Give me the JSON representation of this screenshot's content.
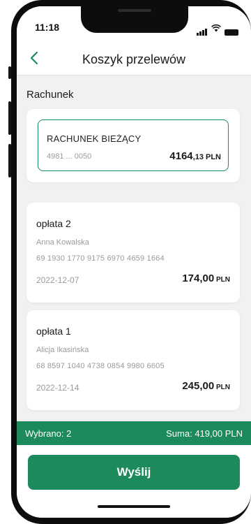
{
  "status_bar": {
    "time": "11:18"
  },
  "header": {
    "title": "Koszyk przelewów"
  },
  "account_section": {
    "label": "Rachunek",
    "account": {
      "name": "RACHUNEK BIEŻĄCY",
      "number": "4981 ... 0050",
      "balance_main": "4164",
      "balance_fraction": ",13 PLN"
    }
  },
  "transfers": [
    {
      "title": "opłata 2",
      "recipient": "Anna Kowalska",
      "account_number": "69 1930 1770 9175 6970 4659 1664",
      "date": "2022-12-07",
      "amount_main": "174,00",
      "currency": " PLN"
    },
    {
      "title": "opłata 1",
      "recipient": "Alicja Ikasińska",
      "account_number": "68 8597 1040 4738 0854 9980 6605",
      "date": "2022-12-14",
      "amount_main": "245,00",
      "currency": " PLN"
    }
  ],
  "summary": {
    "selected": "Wybrano: 2",
    "total": "Suma: 419,00 PLN"
  },
  "actions": {
    "send_label": "Wyślij"
  },
  "colors": {
    "accent": "#1d8a5b",
    "background": "#f1f1f1"
  },
  "icons": {
    "back": "chevron-left-icon",
    "signal": "signal-icon",
    "wifi": "wifi-icon",
    "battery": "battery-icon"
  }
}
